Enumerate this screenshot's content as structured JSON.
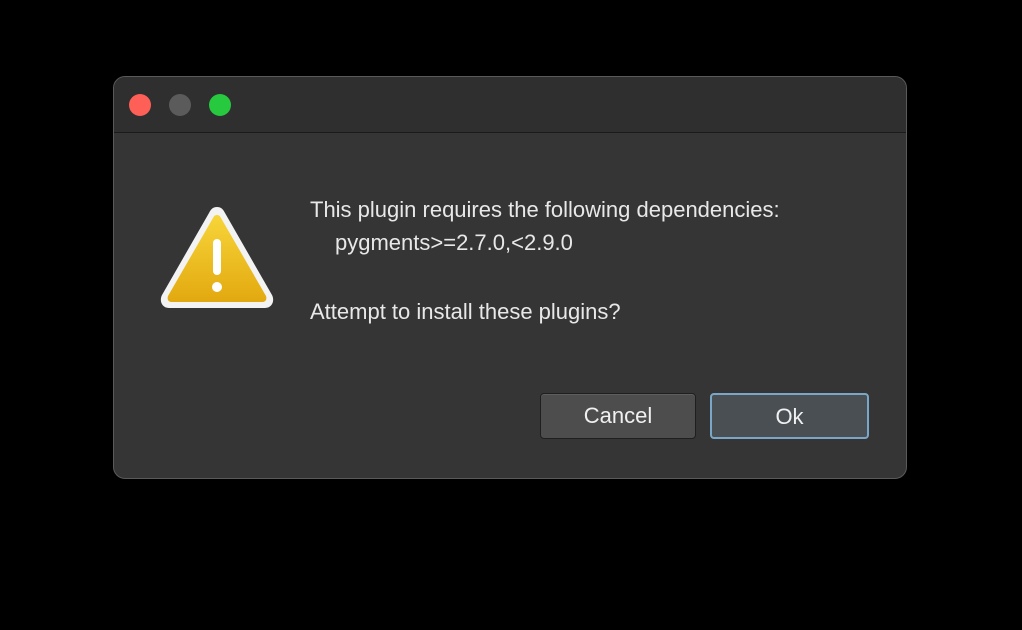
{
  "dialog": {
    "message_line1": "This plugin requires the following dependencies:",
    "message_line2": "pygments>=2.7.0,<2.9.0",
    "message_line3": "Attempt to install these plugins?",
    "icon": "warning-icon",
    "cancel_label": "Cancel",
    "ok_label": "Ok"
  },
  "colors": {
    "background": "#000000",
    "dialog_bg": "#353535",
    "close": "#fe5f57",
    "minimize": "#5b5b5b",
    "zoom": "#27c93f",
    "warning_fill": "#f2be1c",
    "ok_focus_ring": "#7aa7c7"
  }
}
